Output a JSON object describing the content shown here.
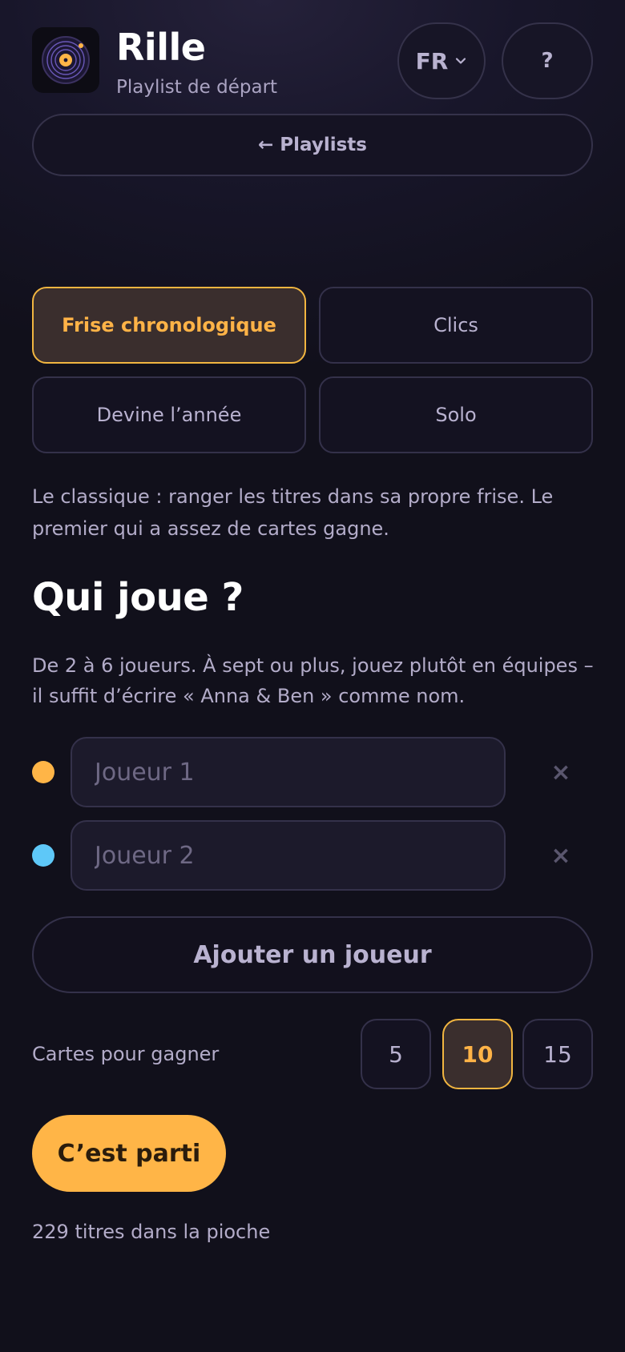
{
  "header": {
    "title": "Rille",
    "subtitle": "Playlist de départ",
    "icon": "vinyl-record-icon",
    "lang_label": "FR",
    "help_label": "?"
  },
  "nav": {
    "back_label": "← Playlists"
  },
  "modes": [
    {
      "label": "Frise chronologique",
      "active": true
    },
    {
      "label": "Clics",
      "active": false
    },
    {
      "label": "Devine l’année",
      "active": false
    },
    {
      "label": "Solo",
      "active": false
    }
  ],
  "mode_description": "Le classique : ranger les titres dans sa propre frise. Le premier qui a assez de cartes gagne.",
  "players_section": {
    "title": "Qui joue ?",
    "description": "De 2 à 6 joueurs. À sept ou plus, jouez plutôt en équipes – il suffit d’écrire « Anna & Ben » comme nom.",
    "players": [
      {
        "placeholder": "Joueur 1",
        "value": "",
        "color": "#ffb547"
      },
      {
        "placeholder": "Joueur 2",
        "value": "",
        "color": "#5ec8f8"
      }
    ],
    "remove_label": "×",
    "add_label": "Ajouter un joueur"
  },
  "cards_to_win": {
    "label": "Cartes pour gagner",
    "options": [
      "5",
      "10",
      "15"
    ],
    "selected": "10"
  },
  "start_label": "C’est parti",
  "deck_count": "229 titres dans la pioche",
  "colors": {
    "accent": "#ffb547",
    "background": "#11101b",
    "border": "#34314a"
  }
}
